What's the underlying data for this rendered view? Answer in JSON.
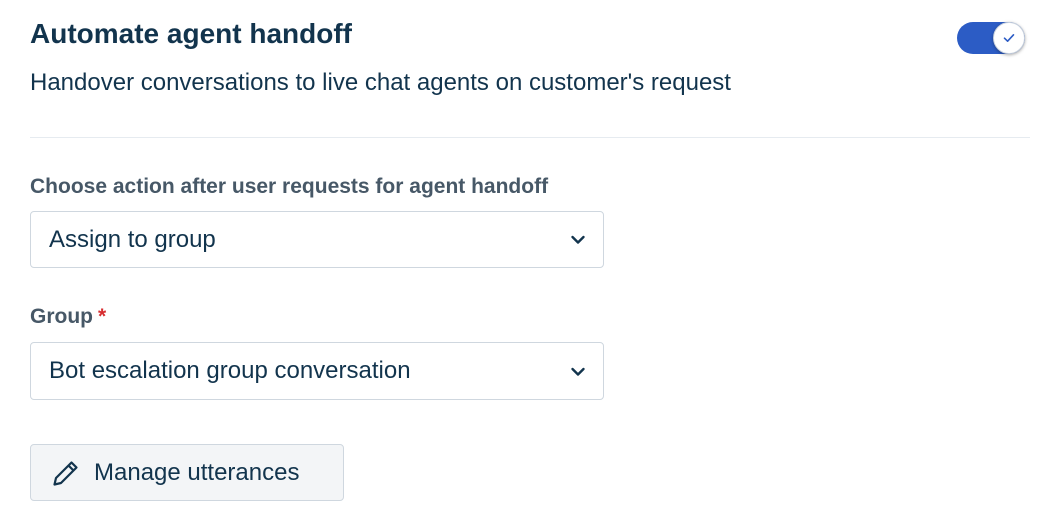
{
  "handoff": {
    "title": "Automate agent handoff",
    "description": "Handover conversations to live chat agents on customer's request",
    "toggle_enabled": true
  },
  "action_field": {
    "label": "Choose action after user requests for agent handoff",
    "selected_value": "Assign to group",
    "icon": "chevron-down-icon"
  },
  "group_field": {
    "label": "Group",
    "required_marker": "*",
    "selected_value": "Bot escalation group conversation",
    "icon": "chevron-down-icon"
  },
  "manage_button": {
    "label": "Manage utterances",
    "icon": "pencil-icon"
  },
  "colors": {
    "toggle_on": "#2c5cc5",
    "heading_text": "#12344d",
    "label_text": "#475867",
    "required": "#d72d30",
    "border": "#cfd7df",
    "button_bg": "#f3f5f7"
  }
}
